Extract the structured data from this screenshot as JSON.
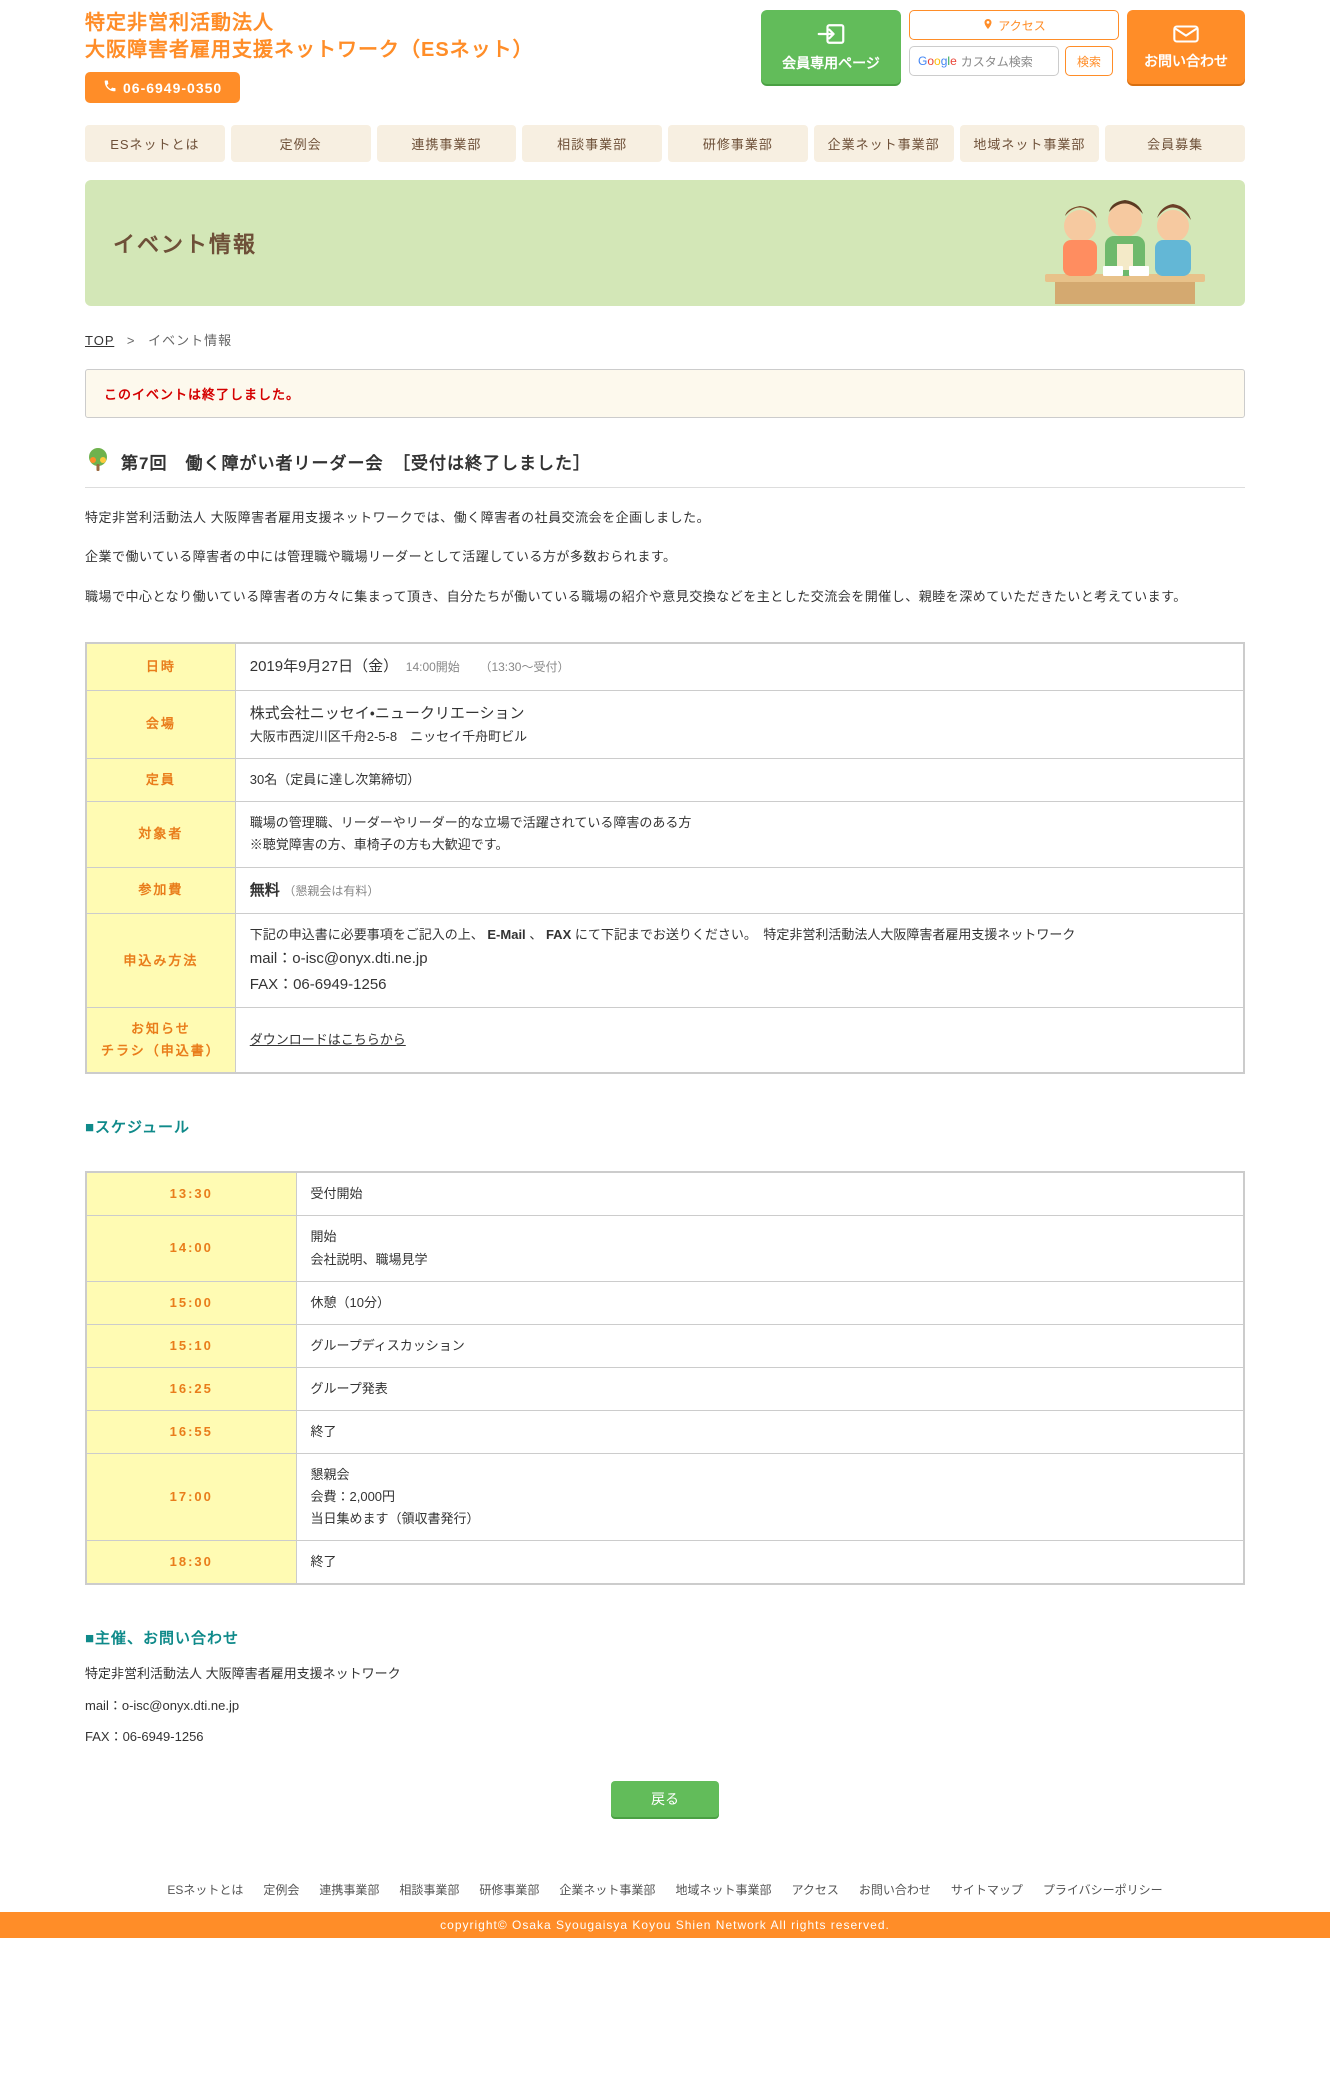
{
  "site": {
    "name_line1": "特定非営利活動法人",
    "name_line2": "大阪障害者雇用支援ネットワーク（ESネット）",
    "phone": "06-6949-0350"
  },
  "header_buttons": {
    "member": "会員専用ページ",
    "access": "アクセス",
    "search_placeholder": "カスタム検索",
    "search_btn": "検索",
    "contact": "お問い合わせ"
  },
  "nav": [
    "ESネットとは",
    "定例会",
    "連携事業部",
    "相談事業部",
    "研修事業部",
    "企業ネット事業部",
    "地域ネット事業部",
    "会員募集"
  ],
  "hero_title": "イベント情報",
  "crumbs": {
    "top": "TOP",
    "sep": ">",
    "current": "イベント情報"
  },
  "notice": "このイベントは終了しました。",
  "event_title": "第7回　働く障がい者リーダー会　［受付は終了しました］",
  "paragraphs": [
    "特定非営利活動法人 大阪障害者雇用支援ネットワークでは、働く障害者の社員交流会を企画しました。",
    "企業で働いている障害者の中には管理職や職場リーダーとして活躍している方が多数おられます。",
    "職場で中心となり働いている障害者の方々に集まって頂き、自分たちが働いている職場の紹介や意見交換などを主とした交流会を開催し、親睦を深めていただきたいと考えています。"
  ],
  "info": {
    "labels": {
      "datetime": "日時",
      "venue": "会場",
      "capacity": "定員",
      "target": "対象者",
      "fee": "参加費",
      "apply": "申込み方法",
      "flyer1": "お知らせ",
      "flyer2": "チラシ（申込書）"
    },
    "datetime_main": "2019年9月27日（金）",
    "datetime_sub1": "14:00開始",
    "datetime_sub2": "（13:30～受付）",
    "venue_main": "株式会社ニッセイ・ニュークリエーション",
    "venue_sub": "大阪市西淀川区千舟2-5-8　ニッセイ千舟町ビル",
    "capacity": "30名（定員に達し次第締切）",
    "target_l1": "職場の管理職、リーダーやリーダー的な立場で活躍されている障害のある方",
    "target_l2": "※聴覚障害の方、車椅子の方も大歓迎です。",
    "fee_main": "無料",
    "fee_sub": "（懇親会は有料）",
    "apply_pre": "下記の申込書に必要事項をご記入の上、",
    "apply_bold1": "E-Mail",
    "apply_mid": "、",
    "apply_bold2": "FAX",
    "apply_post": "にて下記までお送りください。　特定非営利活動法人大阪障害者雇用支援ネットワーク",
    "apply_mail": "mail：o-isc@onyx.dti.ne.jp",
    "apply_fax": "FAX：06-6949-1256",
    "flyer_link": "ダウンロードはこちらから"
  },
  "schedule_heading": "■スケジュール",
  "schedule": [
    {
      "time": "13:30",
      "body": "受付開始"
    },
    {
      "time": "14:00",
      "body": "開始\n会社説明、職場見学"
    },
    {
      "time": "15:00",
      "body": "休憩（10分）"
    },
    {
      "time": "15:10",
      "body": "グループディスカッション"
    },
    {
      "time": "16:25",
      "body": "グループ発表"
    },
    {
      "time": "16:55",
      "body": "終了"
    },
    {
      "time": "17:00",
      "body": "懇親会\n会費：2,000円\n当日集めます（領収書発行）"
    },
    {
      "time": "18:30",
      "body": "終了"
    }
  ],
  "contact_heading": "■主催、お問い合わせ",
  "contact": {
    "org": "特定非営利活動法人 大阪障害者雇用支援ネットワーク",
    "mail": "mail：o-isc@onyx.dti.ne.jp",
    "fax": "FAX：06-6949-1256"
  },
  "back_label": "戻る",
  "footer_nav": [
    "ESネットとは",
    "定例会",
    "連携事業部",
    "相談事業部",
    "研修事業部",
    "企業ネット事業部",
    "地域ネット事業部",
    "アクセス",
    "お問い合わせ",
    "サイトマップ",
    "プライバシーポリシー"
  ],
  "copyright": "copyright© Osaka Syougaisya Koyou Shien Network All rights reserved."
}
